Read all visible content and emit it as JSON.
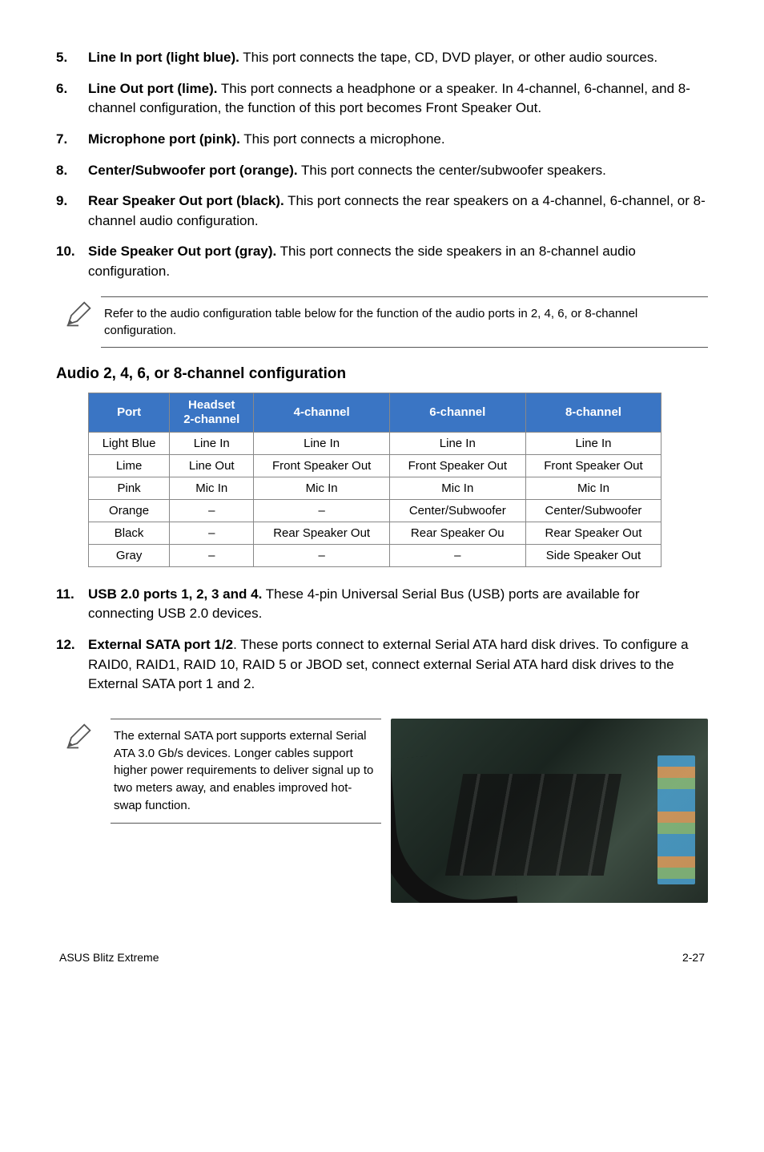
{
  "items": {
    "i5": {
      "num": "5.",
      "lead": "Line In port (light blue).",
      "text": " This port connects the tape, CD, DVD player, or other audio sources."
    },
    "i6": {
      "num": "6.",
      "lead": "Line Out port (lime).",
      "text": " This port connects a headphone or a speaker. In 4-channel, 6-channel, and 8-channel configuration, the function of this port becomes Front Speaker Out."
    },
    "i7": {
      "num": "7.",
      "lead": "Microphone port (pink).",
      "text": " This port connects a microphone."
    },
    "i8": {
      "num": "8.",
      "lead": "Center/Subwoofer port (orange).",
      "text": " This port connects the center/subwoofer speakers."
    },
    "i9": {
      "num": "9.",
      "lead": "Rear Speaker Out port (black).",
      "text": " This port connects the rear speakers on a 4-channel, 6-channel, or 8-channel audio configuration."
    },
    "i10": {
      "num": "10.",
      "lead": "Side Speaker Out port (gray).",
      "text": " This port connects the side speakers in an 8-channel audio configuration."
    },
    "i11": {
      "num": "11.",
      "lead": "USB 2.0 ports 1, 2, 3 and 4.",
      "text": " These 4-pin Universal Serial Bus (USB) ports are available for connecting USB 2.0 devices."
    },
    "i12": {
      "num": "12.",
      "lead": "External SATA port 1/2",
      "text": ". These ports connect to external Serial ATA hard disk drives. To configure a RAID0, RAID1, RAID 10, RAID 5 or JBOD set, connect external Serial ATA hard disk drives to the External SATA port 1 and 2."
    }
  },
  "note1": "Refer to the audio configuration table below for the function of the audio ports in 2, 4, 6, or 8-channel configuration.",
  "heading": "Audio 2, 4, 6, or 8-channel configuration",
  "chart_data": {
    "type": "table",
    "headers": [
      "Port",
      "Headset 2-channel",
      "4-channel",
      "6-channel",
      "8-channel"
    ],
    "rows": [
      [
        "Light Blue",
        "Line In",
        "Line In",
        "Line In",
        "Line In"
      ],
      [
        "Lime",
        "Line Out",
        "Front Speaker Out",
        "Front Speaker Out",
        "Front Speaker Out"
      ],
      [
        "Pink",
        "Mic In",
        "Mic In",
        "Mic In",
        "Mic In"
      ],
      [
        "Orange",
        "–",
        "–",
        "Center/Subwoofer",
        "Center/Subwoofer"
      ],
      [
        "Black",
        "–",
        "Rear Speaker Out",
        "Rear Speaker Ou",
        "Rear Speaker Out"
      ],
      [
        "Gray",
        "–",
        "–",
        "–",
        "Side Speaker Out"
      ]
    ]
  },
  "note2": "The external SATA port supports external Serial ATA 3.0 Gb/s devices. Longer cables support higher power requirements to deliver signal up to two meters away, and enables improved hot-swap function.",
  "footer": {
    "left": "ASUS Blitz Extreme",
    "right": "2-27"
  }
}
